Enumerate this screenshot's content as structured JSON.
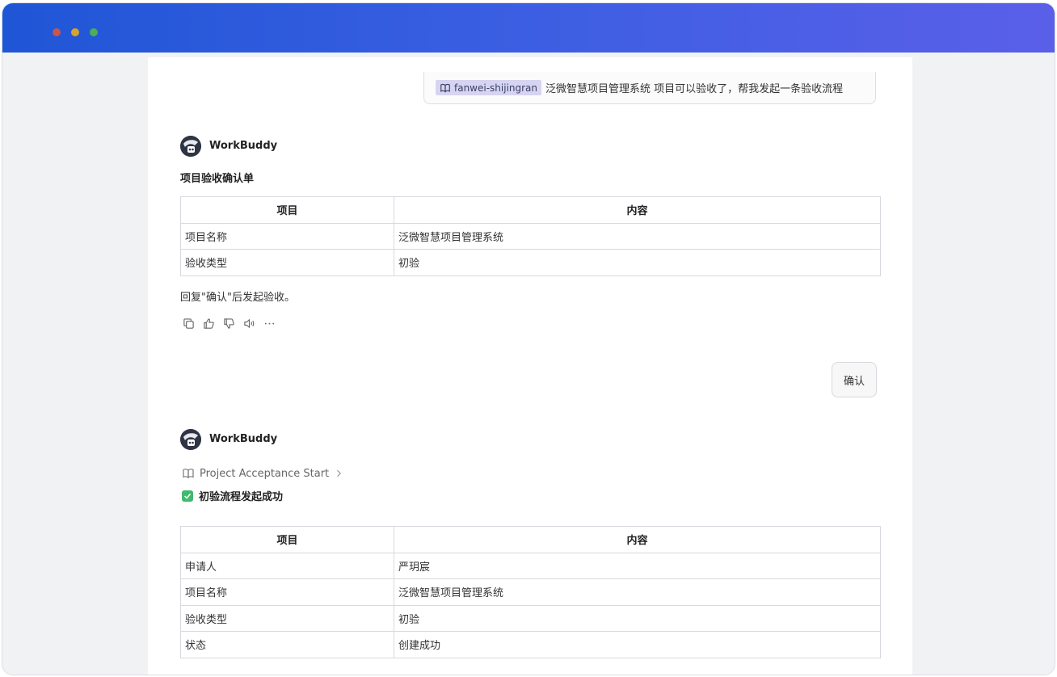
{
  "user_message": {
    "mention_tag": "fanwei-shijingran",
    "text": "泛微智慧项目管理系统 项目可以验收了，帮我发起一条验收流程"
  },
  "bot": {
    "name": "WorkBuddy"
  },
  "reply1": {
    "title": "项目验收确认单",
    "table": {
      "headers": [
        "项目",
        "内容"
      ],
      "rows": [
        [
          "项目名称",
          "泛微智慧项目管理系统"
        ],
        [
          "验收类型",
          "初验"
        ]
      ]
    },
    "footer": "回复\"确认\"后发起验收。"
  },
  "confirm_button": "确认",
  "reply2": {
    "skill": "Project Acceptance Start",
    "status": "初验流程发起成功",
    "table": {
      "headers": [
        "项目",
        "内容"
      ],
      "rows": [
        [
          "申请人",
          "严玥宸"
        ],
        [
          "项目名称",
          "泛微智慧项目管理系统"
        ],
        [
          "验收类型",
          "初验"
        ],
        [
          "状态",
          "创建成功"
        ]
      ]
    }
  },
  "colors": {
    "titlebar_start": "#1f56d6",
    "titlebar_end": "#5a5fe8",
    "mention_bg": "#d7d4f2",
    "success_green": "#3fba6e"
  }
}
